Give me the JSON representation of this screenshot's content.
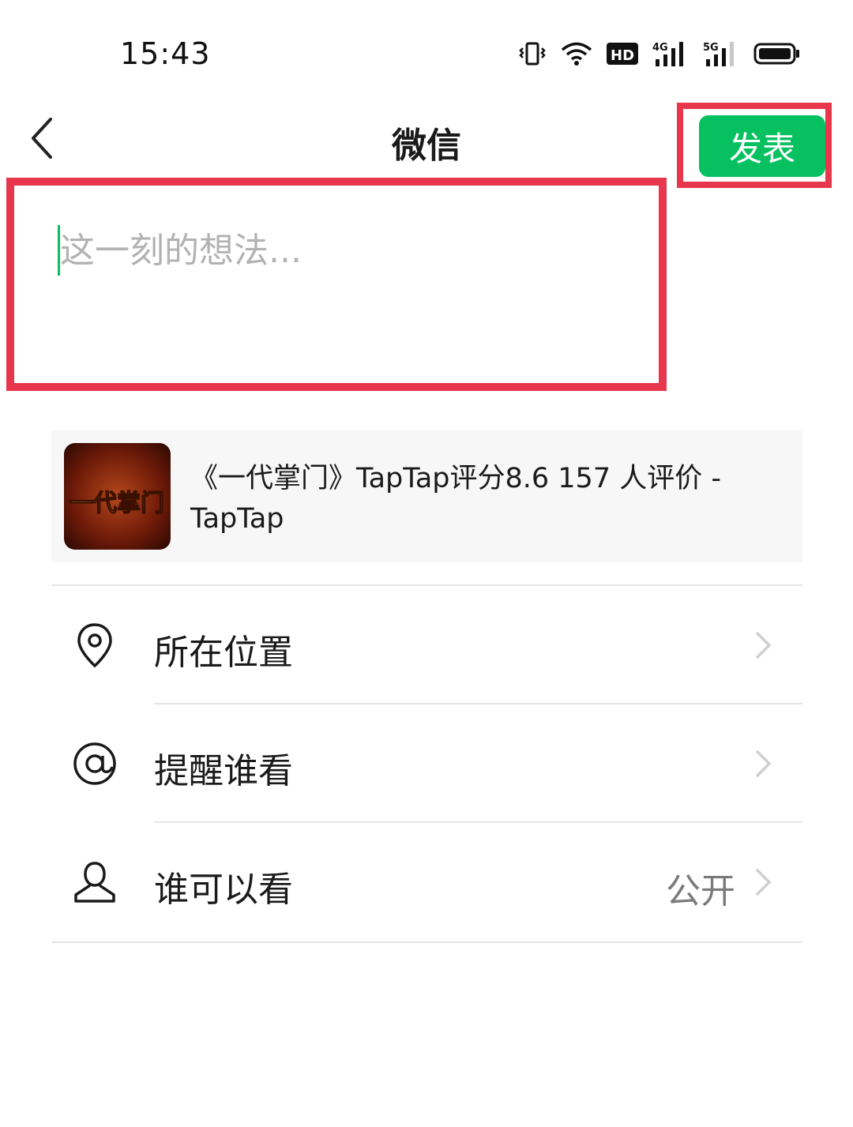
{
  "status_bar": {
    "time": "15:43",
    "icons": [
      "vibrate-icon",
      "wifi-icon",
      "hd-icon",
      "signal-4g-icon",
      "signal-5g-icon",
      "battery-icon"
    ],
    "hd_label": "HD",
    "net1_label": "4G",
    "net2_label": "5G"
  },
  "nav": {
    "title": "微信",
    "publish_label": "发表",
    "accent_color": "#07c160"
  },
  "composer": {
    "placeholder": "这一刻的想法...",
    "value": ""
  },
  "link_card": {
    "title": "《一代掌门》TapTap评分8.6 157 人评价 - TapTap",
    "thumb_text": "一代掌门"
  },
  "options": [
    {
      "label": "所在位置",
      "value": "",
      "icon": "location-icon"
    },
    {
      "label": "提醒谁看",
      "value": "",
      "icon": "at-icon"
    },
    {
      "label": "谁可以看",
      "value": "公开",
      "icon": "person-icon"
    }
  ]
}
